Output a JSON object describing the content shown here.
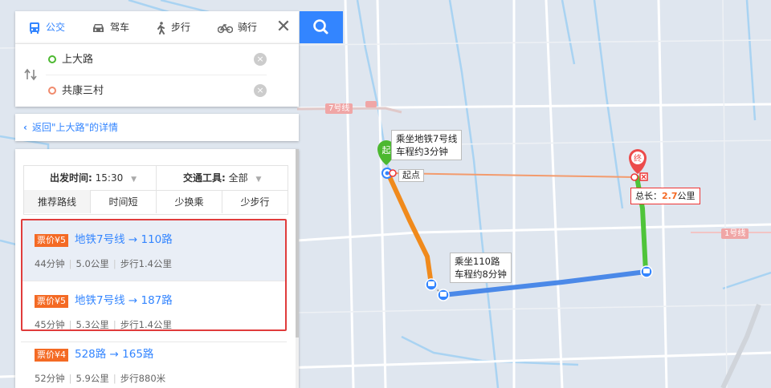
{
  "mode_tabs": [
    {
      "label": "公交",
      "icon": "bus-icon",
      "active": true
    },
    {
      "label": "驾车",
      "icon": "car-icon",
      "active": false
    },
    {
      "label": "步行",
      "icon": "walk-icon",
      "active": false
    },
    {
      "label": "骑行",
      "icon": "bike-icon",
      "active": false
    }
  ],
  "close_label": "✕",
  "start_input": "上大路",
  "end_input": "共康三村",
  "back_link": "返回\"上大路\"的详情",
  "filter": {
    "depart_label": "出发时间:",
    "depart_value": "15:30",
    "tool_label": "交通工具:",
    "tool_value": "全部",
    "tabs": [
      "推荐路线",
      "时间短",
      "少换乘",
      "少步行"
    ]
  },
  "routes": [
    {
      "fare": "票价¥5",
      "name": "地铁7号线 → 110路",
      "time": "44分钟",
      "distance": "5.0公里",
      "walk": "步行1.4公里"
    },
    {
      "fare": "票价¥5",
      "name": "地铁7号线 → 187路",
      "time": "45分钟",
      "distance": "5.3公里",
      "walk": "步行1.4公里"
    },
    {
      "fare": "票价¥4",
      "name": "528路 → 165路",
      "time": "52分钟",
      "distance": "5.9公里",
      "walk": "步行880米"
    }
  ],
  "map": {
    "start_badge": "起",
    "end_badge": "终",
    "start_point_label": "起点",
    "line7_label": "7号线",
    "line1_label": "1号线",
    "callout_metro_line1": "乘坐地铁7号线",
    "callout_metro_line2": "车程约3分钟",
    "callout_bus_line1": "乘坐110路",
    "callout_bus_line2": "车程约8分钟",
    "total_label": "总长：",
    "total_value": "2.7",
    "total_unit": "公里"
  },
  "colors": {
    "accent": "#3385ff",
    "fare": "#f46a24",
    "metro": "#f08a1c",
    "bus": "#4b89e8",
    "walk_end": "#4fc43a",
    "highlight": "#e03c3c"
  }
}
